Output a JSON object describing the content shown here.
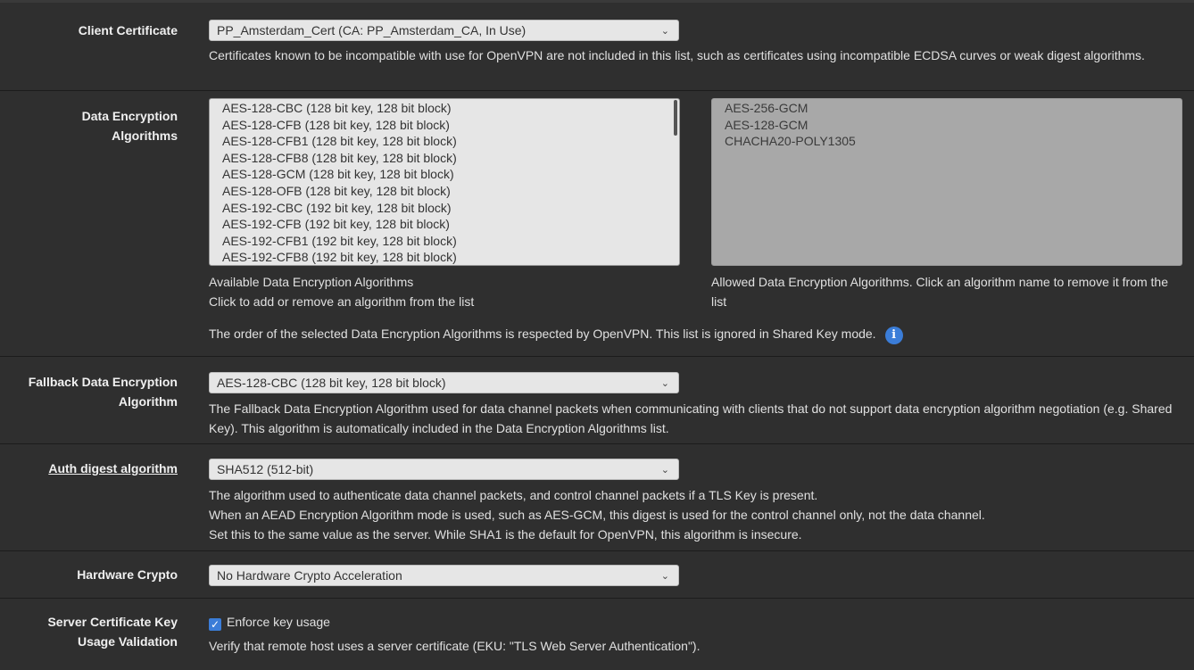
{
  "client_cert": {
    "label": "Client Certificate",
    "selected": "PP_Amsterdam_Cert (CA: PP_Amsterdam_CA, In Use)",
    "help": "Certificates known to be incompatible with use for OpenVPN are not included in this list, such as certificates using incompatible ECDSA curves or weak digest algorithms."
  },
  "data_enc": {
    "label_line1": "Data Encryption",
    "label_line2": "Algorithms",
    "available": [
      "AES-128-CBC (128 bit key, 128 bit block)",
      "AES-128-CFB (128 bit key, 128 bit block)",
      "AES-128-CFB1 (128 bit key, 128 bit block)",
      "AES-128-CFB8 (128 bit key, 128 bit block)",
      "AES-128-GCM (128 bit key, 128 bit block)",
      "AES-128-OFB (128 bit key, 128 bit block)",
      "AES-192-CBC (192 bit key, 128 bit block)",
      "AES-192-CFB (192 bit key, 128 bit block)",
      "AES-192-CFB1 (192 bit key, 128 bit block)",
      "AES-192-CFB8 (192 bit key, 128 bit block)"
    ],
    "allowed": [
      "AES-256-GCM",
      "AES-128-GCM",
      "CHACHA20-POLY1305"
    ],
    "available_help1": "Available Data Encryption Algorithms",
    "available_help2": "Click to add or remove an algorithm from the list",
    "allowed_help": "Allowed Data Encryption Algorithms. Click an algorithm name to remove it from the list",
    "order_note": "The order of the selected Data Encryption Algorithms is respected by OpenVPN. This list is ignored in Shared Key mode.",
    "info_icon": "i"
  },
  "fallback": {
    "label_line1": "Fallback Data Encryption",
    "label_line2": "Algorithm",
    "selected": "AES-128-CBC (128 bit key, 128 bit block)",
    "help": "The Fallback Data Encryption Algorithm used for data channel packets when communicating with clients that do not support data encryption algorithm negotiation (e.g. Shared Key). This algorithm is automatically included in the Data Encryption Algorithms list."
  },
  "auth": {
    "label": "Auth digest algorithm",
    "selected": "SHA512 (512-bit)",
    "help1": "The algorithm used to authenticate data channel packets, and control channel packets if a TLS Key is present.",
    "help2": "When an AEAD Encryption Algorithm mode is used, such as AES-GCM, this digest is used for the control channel only, not the data channel.",
    "help3": "Set this to the same value as the server. While SHA1 is the default for OpenVPN, this algorithm is insecure."
  },
  "hw": {
    "label": "Hardware Crypto",
    "selected": "No Hardware Crypto Acceleration"
  },
  "eku": {
    "label_line1": "Server Certificate Key",
    "label_line2": "Usage Validation",
    "checkbox_label": "Enforce key usage",
    "checked": true,
    "help": "Verify that remote host uses a server certificate (EKU: \"TLS Web Server Authentication\")."
  },
  "icons": {
    "chevron": "⌄",
    "check": "✓"
  },
  "colors": {
    "accent": "#3b7dd8",
    "background": "#2f2f2f"
  }
}
